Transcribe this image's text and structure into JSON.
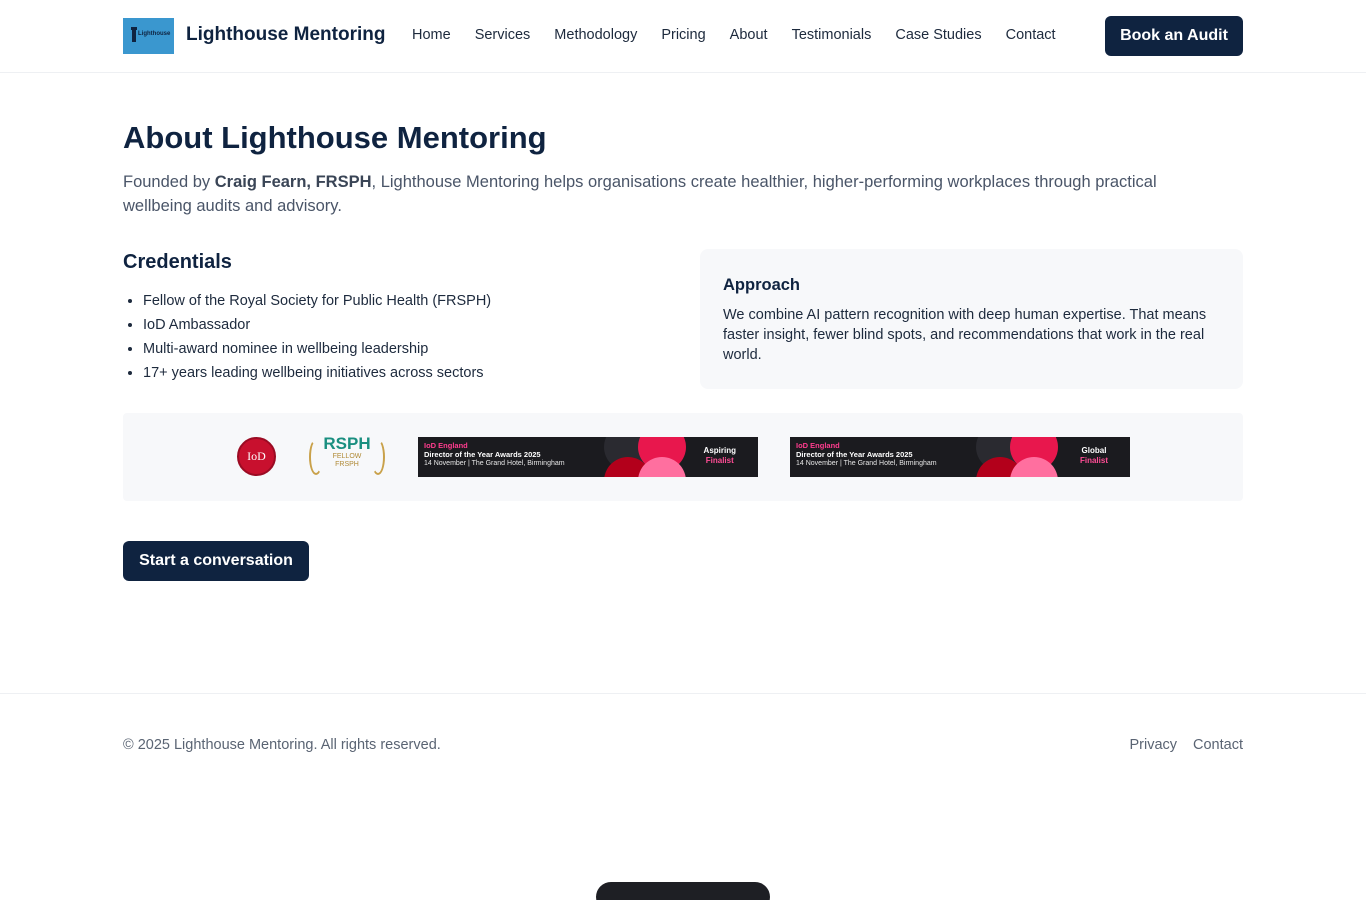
{
  "header": {
    "logo_text": "Lighthouse",
    "brand": "Lighthouse Mentoring",
    "nav": [
      "Home",
      "Services",
      "Methodology",
      "Pricing",
      "About",
      "Testimonials",
      "Case Studies",
      "Contact"
    ],
    "cta_label": "Book an Audit"
  },
  "main": {
    "title": "About Lighthouse Mentoring",
    "intro_prefix": "Founded by ",
    "intro_founder": "Craig Fearn, FRSPH",
    "intro_suffix": ", Lighthouse Mentoring helps organisations create healthier, higher-performing workplaces through practical wellbeing audits and advisory.",
    "credentials_title": "Credentials",
    "credentials": [
      "Fellow of the Royal Society for Public Health (FRSPH)",
      "IoD Ambassador",
      "Multi-award nominee in wellbeing leadership",
      "17+ years leading wellbeing initiatives across sectors"
    ],
    "approach_title": "Approach",
    "approach_text": "We combine AI pattern recognition with deep human expertise. That means faster insight, fewer blind spots, and recommendations that work in the real world.",
    "badges": {
      "iod_text": "IoD",
      "rsph_title": "RSPH",
      "rsph_line1": "FELLOW",
      "rsph_line2": "FRSPH",
      "banners": [
        {
          "org": "IoD England",
          "event": "Director of the Year Awards 2025",
          "date": "14 November  |  The Grand Hotel, Birmingham",
          "tag1": "Aspiring",
          "tag2": "Finalist"
        },
        {
          "org": "IoD England",
          "event": "Director of the Year Awards 2025",
          "date": "14 November  |  The Grand Hotel, Birmingham",
          "tag1": "Global",
          "tag2": "Finalist"
        }
      ]
    },
    "conversation_label": "Start a conversation"
  },
  "footer": {
    "copyright": "© 2025 Lighthouse Mentoring. All rights reserved.",
    "links": [
      "Privacy",
      "Contact"
    ]
  },
  "colors": {
    "primary": "#0f2340",
    "logo_bg": "#3a97cf",
    "panel_bg": "#f7f8fa"
  }
}
